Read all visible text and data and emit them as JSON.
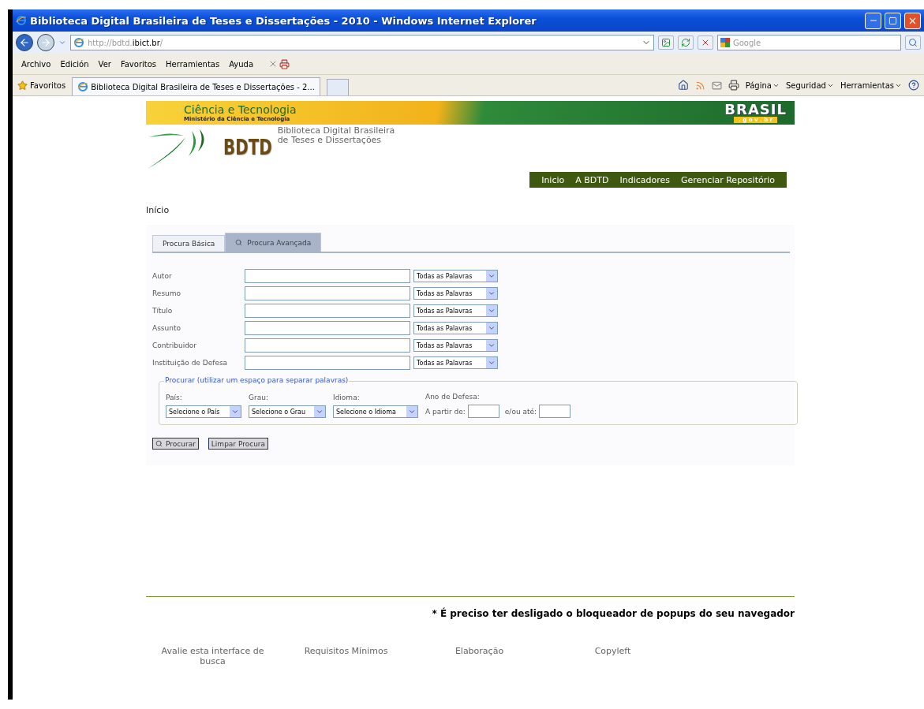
{
  "window": {
    "title": "Biblioteca Digital Brasileira de Teses e Dissertações - 2010 - Windows Internet Explorer"
  },
  "address_bar": {
    "url_prefix": "http://bdtd.",
    "url_domain": "ibict.br",
    "url_suffix": "/"
  },
  "search_box": {
    "placeholder": "Google"
  },
  "menu": [
    "Archivo",
    "Edición",
    "Ver",
    "Favoritos",
    "Herramientas",
    "Ayuda"
  ],
  "favorites_bar": {
    "label": "Favoritos",
    "tab_title": "Biblioteca Digital Brasileira de Teses e Dissertações - 2..."
  },
  "command_bar": [
    "Página",
    "Seguridad",
    "Herramientas"
  ],
  "banner": {
    "title": "Ciência e Tecnologia",
    "subtitle": "Ministério da Ciência e Tecnologia",
    "brand": "BRASIL",
    "brand_sub": ". g o v . b r"
  },
  "logo": {
    "name": "BDTD",
    "tagline": [
      "Biblioteca Digital Brasileira",
      "de Teses e Dissertações"
    ]
  },
  "nav": [
    "Inicio",
    "A BDTD",
    "Indicadores",
    "Gerenciar Repositório"
  ],
  "breadcrumb": "Início",
  "tabs": [
    {
      "label": "Procura Básica",
      "selected": false,
      "kind": "plain"
    },
    {
      "label": "Procura Avançada",
      "selected": true,
      "kind": "search"
    }
  ],
  "fields": [
    {
      "label": "Autor",
      "match": "Todas as Palavras"
    },
    {
      "label": "Resumo",
      "match": "Todas as Palavras"
    },
    {
      "label": "Título",
      "match": "Todas as Palavras"
    },
    {
      "label": "Assunto",
      "match": "Todas as Palavras"
    },
    {
      "label": "Contribuidor",
      "match": "Todas as Palavras"
    },
    {
      "label": "Instituição de Defesa",
      "match": "Todas as Palavras"
    }
  ],
  "filters": {
    "legend": "Procurar (utilizar um espaço para separar palavras)",
    "selects": [
      {
        "label": "País:",
        "value": "Selecione o País"
      },
      {
        "label": "Grau:",
        "value": "Selecione o Grau"
      },
      {
        "label": "Idioma:",
        "value": "Selecione o Idioma"
      }
    ],
    "year": {
      "label": "Ano de Defesa:",
      "from": "A partir de:",
      "to": "e/ou até:"
    }
  },
  "buttons": [
    {
      "label": "Procurar",
      "kind": "search"
    },
    {
      "label": "Limpar Procura",
      "kind": "plain"
    }
  ],
  "notice": "* É preciso ter desligado o bloqueador de popups do seu navegador",
  "footer_links": [
    "Avalie esta interface de busca",
    "Requisitos Mínimos",
    "Elaboração",
    "Copyleft"
  ]
}
